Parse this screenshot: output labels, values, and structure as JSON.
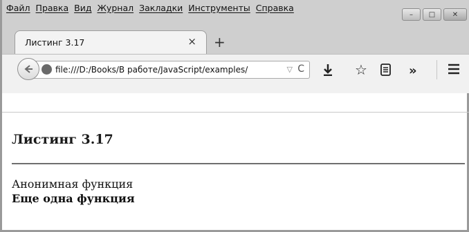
{
  "menu": {
    "items": [
      "Файл",
      "Правка",
      "Вид",
      "Журнал",
      "Закладки",
      "Инструменты",
      "Справка"
    ]
  },
  "tab": {
    "title": "Листинг 3.17",
    "close_glyph": "×",
    "new_tab_glyph": "+"
  },
  "window": {
    "minimize_glyph": "–",
    "maximize_glyph": "□",
    "close_glyph": "✕"
  },
  "navbar": {
    "url": "file:///D:/Books/В работе/JavaScript/examples/",
    "icons": [
      "back-arrow-icon",
      "globe-icon",
      "dropdown-icon",
      "reload-icon",
      "download-icon",
      "bookmark-star-icon",
      "reading-list-icon",
      "overflow-chevron-icon",
      "menu-icon"
    ]
  },
  "page": {
    "heading": "Листинг 3.17",
    "line1": "Анонимная функция",
    "line2": "Еще одна функция"
  }
}
